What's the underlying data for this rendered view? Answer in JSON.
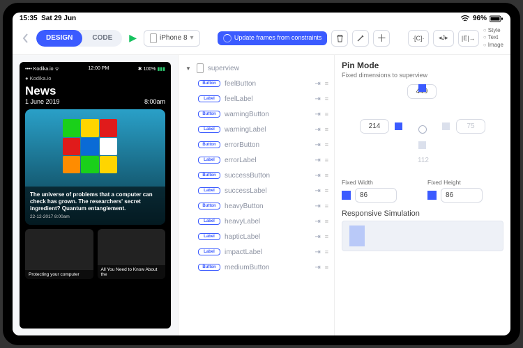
{
  "status": {
    "time": "15:35",
    "date": "Sat 29 Jun",
    "battery": "96%"
  },
  "toolbar": {
    "tabs": {
      "design": "DESIGN",
      "code": "CODE"
    },
    "device": "iPhone 8",
    "update": "Update frames from constraints",
    "modebuttons": [
      "C",
      "J",
      "E"
    ],
    "radios": [
      "Style",
      "Text",
      "Image"
    ]
  },
  "phone": {
    "status": {
      "carrier": "Kodika.io",
      "time": "12:00 PM",
      "bat": "100%"
    },
    "brand": "Kodika.io",
    "title": "News",
    "date": "1 June 2019",
    "hour": "8:00am",
    "card": {
      "headline": "The universe of problems that a computer can check has grown. The researchers' secret ingredient? Quantum entanglement.",
      "dateline": "22-12-2017 8:00am"
    },
    "small1": "Protecting your computer",
    "small2": "All You Need to Know About the"
  },
  "tree": {
    "root": "superview",
    "items": [
      {
        "t": "Button",
        "n": "feelButton"
      },
      {
        "t": "Label",
        "n": "feelLabel"
      },
      {
        "t": "Button",
        "n": "warningButton"
      },
      {
        "t": "Label",
        "n": "warningLabel"
      },
      {
        "t": "Button",
        "n": "errorButton"
      },
      {
        "t": "Label",
        "n": "errorLabel"
      },
      {
        "t": "Button",
        "n": "successButton"
      },
      {
        "t": "Label",
        "n": "successLabel"
      },
      {
        "t": "Button",
        "n": "heavyButton"
      },
      {
        "t": "Label",
        "n": "heavyLabel"
      },
      {
        "t": "Label",
        "n": "hapticLabel"
      },
      {
        "t": "Label",
        "n": "impactLabel"
      },
      {
        "t": "Button",
        "n": "mediumButton"
      }
    ]
  },
  "pin": {
    "title": "Pin Mode",
    "subtitle": "Fixed dimensions to superview",
    "top": "449",
    "left": "214",
    "right": "75",
    "bottom": "112",
    "fixedWidthLabel": "Fixed Width",
    "fixedWidth": "86",
    "fixedHeightLabel": "Fixed Height",
    "fixedHeight": "86",
    "responsive": "Responsive Simulation"
  }
}
